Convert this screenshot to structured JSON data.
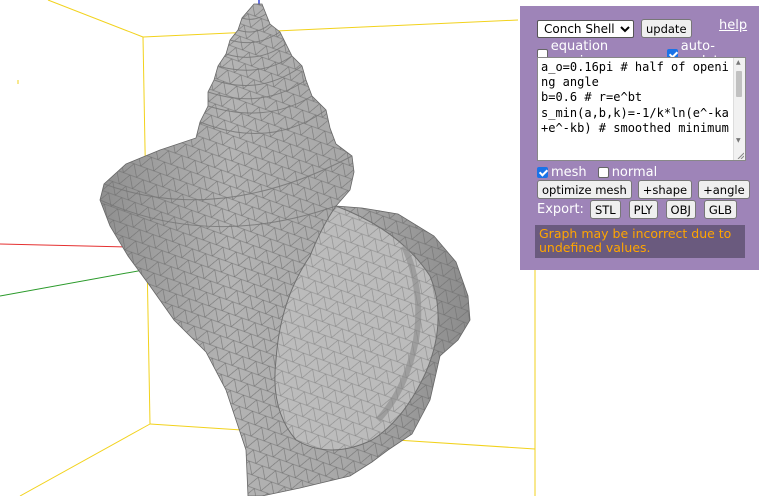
{
  "controls": {
    "preset_selected": "Conch Shell",
    "update_label": "update",
    "help_label": "help",
    "equation_preview_label": "equation preview",
    "equation_preview_checked": false,
    "auto_update_label": "auto-update",
    "auto_update_checked": true
  },
  "editor": {
    "text": "a_o=0.16pi # half of opening angle\nb=0.6 # r=e^bt\ns_min(a,b,k)=-1/k*ln(e^-ka+e^-kb) # smoothed minimum"
  },
  "display": {
    "mesh_label": "mesh",
    "mesh_checked": true,
    "normal_label": "normal",
    "normal_checked": false
  },
  "actions": {
    "optimize_mesh_label": "optimize mesh",
    "add_shape_label": "+shape",
    "add_angle_label": "+angle"
  },
  "export": {
    "label": "Export:",
    "formats": [
      "STL",
      "PLY",
      "OBJ",
      "GLB"
    ]
  },
  "warning": {
    "text": "Graph may be incorrect due to undefined values."
  },
  "colors": {
    "panel_bg": "#9e84b8",
    "warning_bg": "#6a5a7e",
    "warning_text": "#ffa500",
    "box_lines": "#f2d21c",
    "axis_x": "#e53030",
    "axis_y": "#2a9a2a",
    "axis_z": "#3344dd",
    "mesh_fill": "#a9a9a9"
  }
}
